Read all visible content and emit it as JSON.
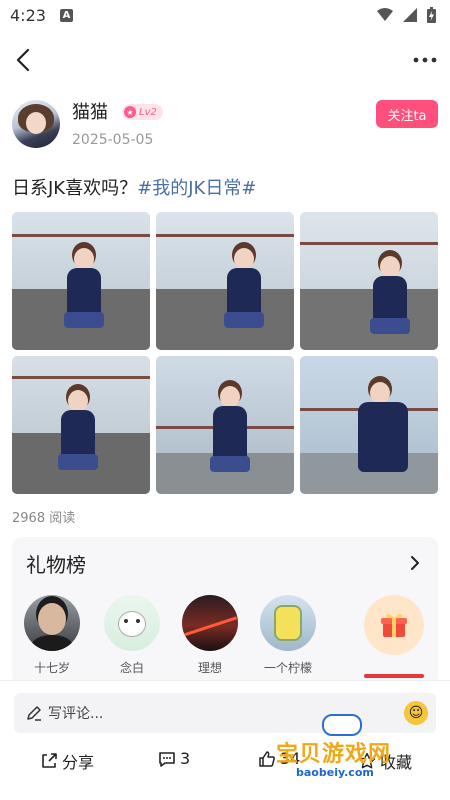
{
  "status_bar": {
    "time": "4:23",
    "indicator": "A"
  },
  "post": {
    "author": {
      "name": "猫猫",
      "level": "Lv2"
    },
    "date": "2025-05-05",
    "follow_label": "关注ta",
    "text": "日系JK喜欢吗？",
    "hashtag": "#我的JK日常#",
    "read_count": "2968 阅读"
  },
  "gift_board": {
    "title": "礼物榜",
    "users": [
      {
        "name": "十七岁"
      },
      {
        "name": "念白"
      },
      {
        "name": "理想"
      },
      {
        "name": "一个柠檬"
      }
    ]
  },
  "bottom_bar": {
    "comment_placeholder": "写评论...",
    "share_label": "分享",
    "comment_count": "3",
    "like_count": "34",
    "favorite_label": "收藏"
  },
  "watermark": {
    "text": "宝贝游戏网",
    "url": "baobeiy.com"
  },
  "colors": {
    "accent": "#ff4f7b",
    "hashtag": "#4a6fa5",
    "gift_bg": "#ffe6c9"
  }
}
